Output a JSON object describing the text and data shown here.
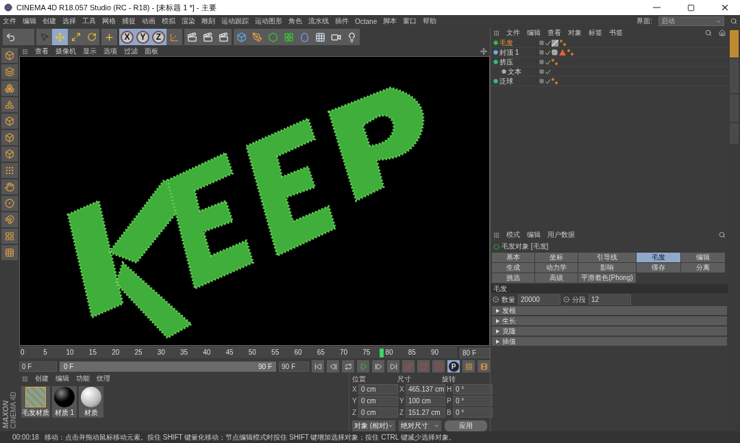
{
  "window": {
    "title": "CINEMA 4D R18.057 Studio (RC - R18) - [未标题 1 *] - 主要"
  },
  "menu": [
    "文件",
    "编辑",
    "创建",
    "选择",
    "工具",
    "网格",
    "捕捉",
    "动画",
    "模拟",
    "渲染",
    "雕刻",
    "运动跟踪",
    "运动图形",
    "角色",
    "流水线",
    "插件",
    "Octane",
    "脚本",
    "窗口",
    "帮助"
  ],
  "layout": {
    "label": "界面:",
    "value": "启动"
  },
  "axis_buttons": [
    {
      "label": "X",
      "selected": true
    },
    {
      "label": "Y",
      "selected": true
    },
    {
      "label": "Z",
      "selected": true
    }
  ],
  "viewport": {
    "menu": [
      "查看",
      "摄像机",
      "显示",
      "选项",
      "过滤",
      "面板"
    ]
  },
  "objects": {
    "menu": [
      "文件",
      "编辑",
      "查看",
      "对象",
      "标签",
      "书签"
    ],
    "items": [
      {
        "name": "毛发",
        "selected": true,
        "kind": "hair"
      },
      {
        "name": "封顶 1",
        "selected": false,
        "kind": "light"
      },
      {
        "name": "挤压",
        "selected": false,
        "kind": "generator",
        "children": [
          {
            "name": "文本",
            "selected": false,
            "kind": "spline"
          }
        ]
      },
      {
        "name": "泛球",
        "selected": false,
        "kind": "generator"
      }
    ]
  },
  "attributes": {
    "menu": [
      "模式",
      "编辑",
      "用户数据"
    ],
    "title": "毛发对象 [毛发]",
    "tabs": [
      {
        "label": "基本",
        "selected": false
      },
      {
        "label": "坐标",
        "selected": false
      },
      {
        "label": "引导线",
        "selected": false
      },
      {
        "label": "毛发",
        "selected": true
      },
      {
        "label": "编辑",
        "selected": false
      },
      {
        "label": "生成",
        "selected": false
      },
      {
        "label": "动力学",
        "selected": false
      },
      {
        "label": "影响",
        "selected": false
      },
      {
        "label": "缓存",
        "selected": false
      },
      {
        "label": "分离",
        "selected": false
      },
      {
        "label": "挑选",
        "selected": false
      },
      {
        "label": "高级",
        "selected": false
      },
      {
        "label": "平滑着色(Phong)",
        "selected": false
      }
    ],
    "section": "毛发",
    "fields": [
      {
        "label": "数量",
        "value": "20000"
      },
      {
        "label": "分段",
        "value": "12"
      }
    ],
    "groups": [
      {
        "label": "发根",
        "expanded": false
      },
      {
        "label": "生长",
        "expanded": false
      },
      {
        "label": "克隆",
        "expanded": false
      },
      {
        "label": "插值",
        "expanded": false
      }
    ]
  },
  "timeline": {
    "ticks": [
      "0",
      "5",
      "10",
      "15",
      "20",
      "25",
      "30",
      "35",
      "40",
      "45",
      "50",
      "55",
      "60",
      "65",
      "70",
      "75",
      "80",
      "85",
      "90"
    ],
    "level": 0.833,
    "current": "80 F",
    "start": "0 F",
    "range": {
      "start": "0 F",
      "end": "90 F",
      "level": 1
    },
    "end": "90 F",
    "key_label": "P"
  },
  "materials": {
    "menu": [
      "创建",
      "编辑",
      "功能",
      "纹理"
    ],
    "items": [
      {
        "name": "毛发材质",
        "kind": "striped"
      },
      {
        "name": "材质 1",
        "kind": "black"
      },
      {
        "name": "材质",
        "kind": "white"
      }
    ]
  },
  "coordinates": {
    "headers": [
      "位置",
      "尺寸",
      "旋转"
    ],
    "rows": [
      [
        {
          "axis": "X",
          "value": "0 cm"
        },
        {
          "axis": "X",
          "value": "465.137 cm"
        },
        {
          "axis": "H",
          "value": "0 °"
        }
      ],
      [
        {
          "axis": "Y",
          "value": "0 cm"
        },
        {
          "axis": "Y",
          "value": "100 cm"
        },
        {
          "axis": "P",
          "value": "0 °"
        }
      ],
      [
        {
          "axis": "Z",
          "value": "0 cm"
        },
        {
          "axis": "Z",
          "value": "151.27 cm"
        },
        {
          "axis": "B",
          "value": "0 °"
        }
      ]
    ],
    "mode": "对象 (相对)",
    "size_mode": "绝对尺寸",
    "apply": "应用"
  },
  "side_tabs": [
    {
      "selected": true
    },
    {
      "selected": false
    },
    {
      "selected": false
    },
    {
      "selected": false
    }
  ],
  "logo": {
    "brand": "MAXON",
    "product": "CINEMA 4D"
  },
  "status": {
    "time": "00:00:18",
    "message": "移动：点击并拖动鼠标移动元素。按住 SHIFT 键量化移动；节点编辑模式时按住 SHIFT 键增加选择对象；按住 CTRL 键减少选择对象。"
  }
}
